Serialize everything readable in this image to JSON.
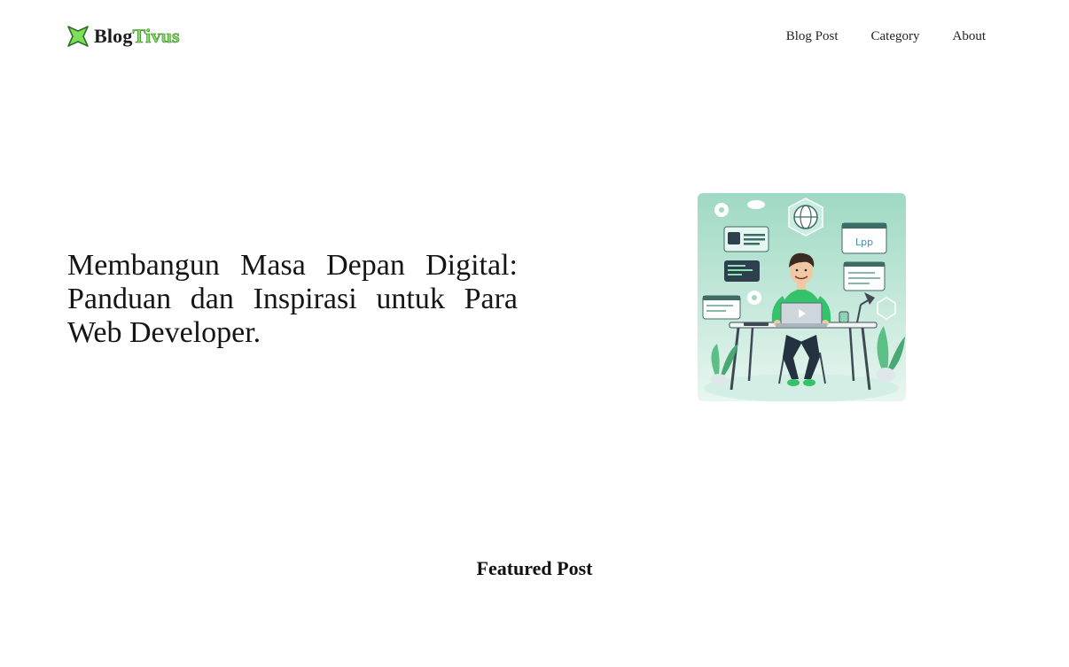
{
  "header": {
    "logo": {
      "icon": "star-badge-icon",
      "text_main": "Blog",
      "text_accent": "Tivus"
    },
    "nav": [
      {
        "label": "Blog Post"
      },
      {
        "label": "Category"
      },
      {
        "label": "About"
      }
    ]
  },
  "hero": {
    "title": "Membangun Masa Depan Digital: Panduan dan Inspirasi untuk Para Web Developer.",
    "illustration": {
      "badge_text": "Lpp"
    }
  },
  "featured": {
    "title": "Featured Post"
  },
  "colors": {
    "logo_accent": "#7ee05a",
    "illustration_bg": "#bfe7d8",
    "illustration_shirt": "#34c36a"
  }
}
